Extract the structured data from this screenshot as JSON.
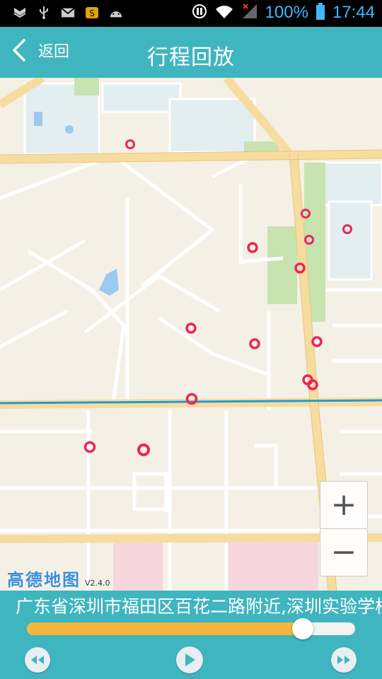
{
  "status_bar": {
    "battery": "100%",
    "time": "17:44",
    "icons": [
      "shield-icon",
      "usb-icon",
      "mail-icon",
      "app-icon",
      "android-icon",
      "nfc-icon",
      "wifi-icon",
      "signal-icon",
      "battery-icon"
    ]
  },
  "header": {
    "back_label": "返回",
    "title": "行程回放"
  },
  "map": {
    "provider_logo": "高德地图",
    "version": "V2.4.0",
    "zoom_in_label": "+",
    "zoom_out_label": "−",
    "route_color": "#e8275d",
    "track_line_color": "#1f9bd6"
  },
  "playback": {
    "address": "广东省深圳市福田区百花二路附近,深圳实验学校",
    "progress": 0.84,
    "prev_icon": "rewind-icon",
    "play_icon": "play-icon",
    "next_icon": "fast-forward-icon"
  },
  "colors": {
    "accent": "#3fb5bf",
    "progress_fill": "#f4b73d"
  }
}
